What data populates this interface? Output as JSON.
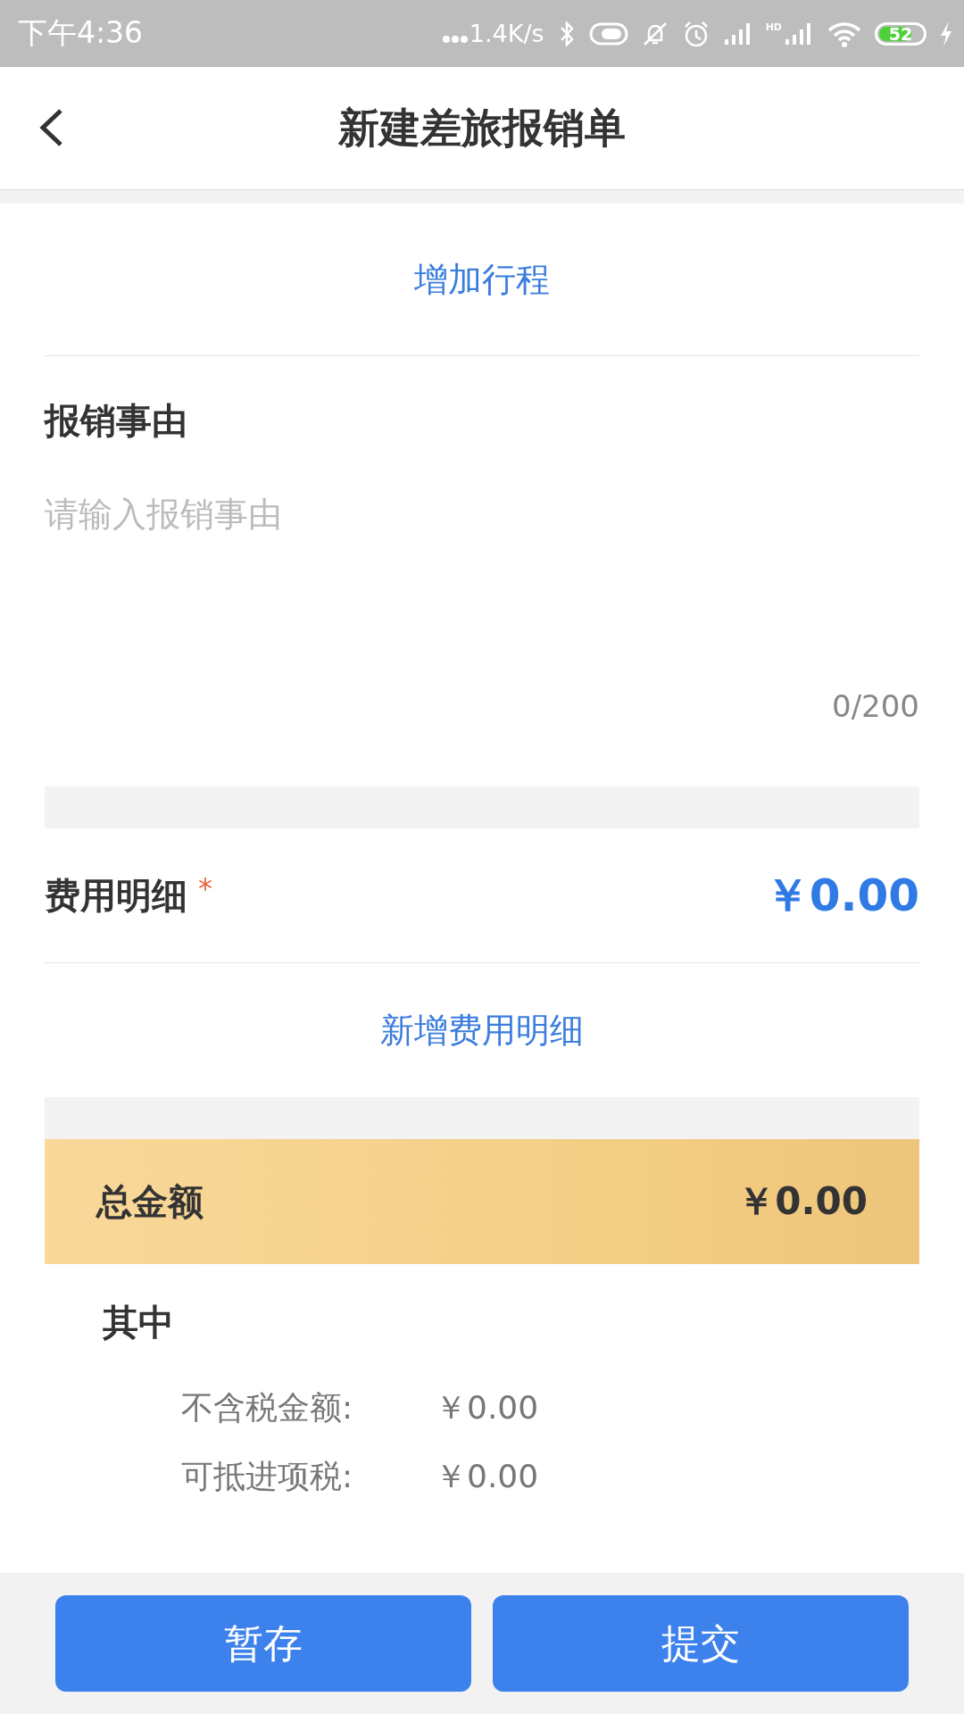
{
  "status_bar": {
    "time": "下午4:36",
    "speed": "1.4K/s",
    "hd_label": "HD",
    "battery": "52"
  },
  "header": {
    "title": "新建差旅报销单"
  },
  "add_trip": "增加行程",
  "reason": {
    "label": "报销事由",
    "placeholder": "请输入报销事由",
    "counter": "0/200"
  },
  "expenses": {
    "label": "费用明细",
    "required": true,
    "required_mark": "*",
    "amount": "￥0.00",
    "add": "新增费用明细"
  },
  "total": {
    "label": "总金额",
    "amount": "￥0.00"
  },
  "breakdown": {
    "title": "其中",
    "rows": [
      {
        "label": "不含税金额:",
        "value": "￥0.00"
      },
      {
        "label": "可抵进项税:",
        "value": "￥0.00"
      }
    ]
  },
  "buttons": [
    {
      "label": "暂存"
    },
    {
      "label": "提交"
    }
  ]
}
